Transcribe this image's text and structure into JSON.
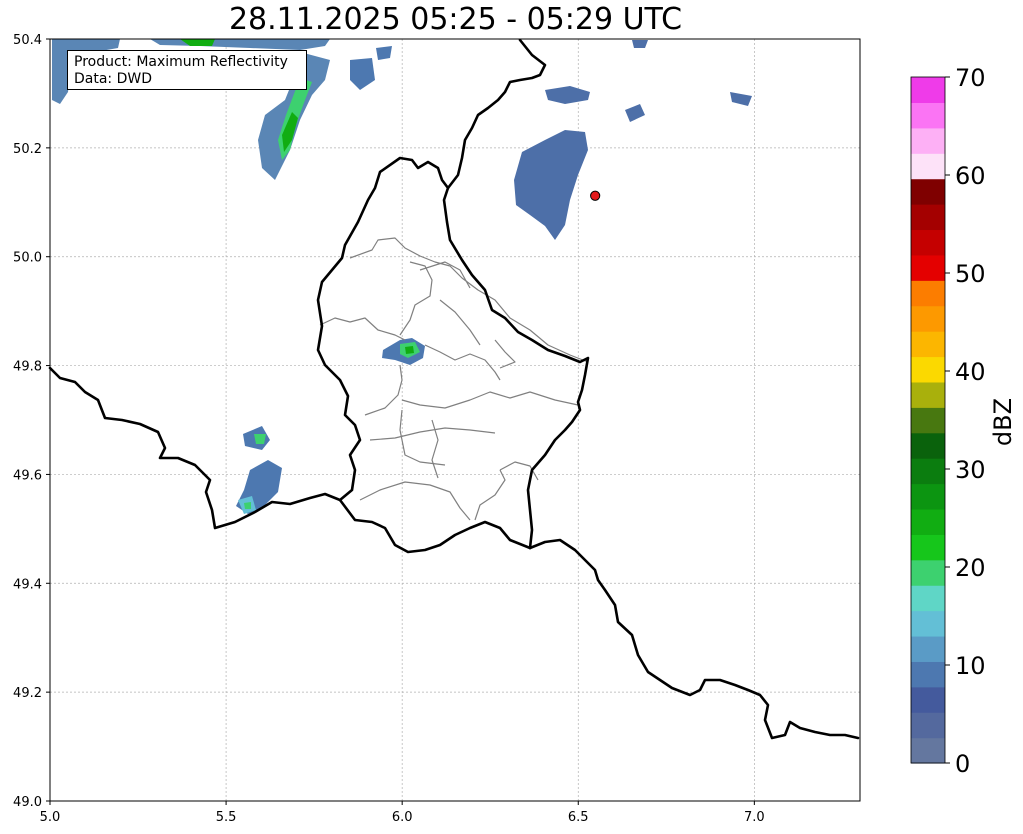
{
  "title": "28.11.2025 05:25 - 05:29 UTC",
  "info": {
    "product_line": "Product: Maximum Reflectivity",
    "data_line": "Data: DWD"
  },
  "map": {
    "lon_range": [
      5.0,
      7.3
    ],
    "lat_range": [
      49.0,
      50.4
    ],
    "x_ticks": [
      "5.0",
      "5.5",
      "6.0",
      "6.5",
      "7.0"
    ],
    "y_ticks": [
      "49.0",
      "49.2",
      "49.4",
      "49.6",
      "49.8",
      "50.0",
      "50.2",
      "50.4"
    ],
    "grid": true,
    "marker": {
      "lon": 6.548,
      "lat": 50.112,
      "color": "#e31a1c"
    }
  },
  "colorbar": {
    "label": "dBZ",
    "ticks": [
      "0",
      "10",
      "20",
      "30",
      "40",
      "50",
      "60",
      "70"
    ],
    "range": [
      0,
      70
    ],
    "colors": [
      "#64779f",
      "#54699e",
      "#445a9d",
      "#4d78b0",
      "#5a9bc6",
      "#63bfd6",
      "#5fd6c6",
      "#3dd16f",
      "#16c61b",
      "#11ad12",
      "#0c9511",
      "#0b7d0f",
      "#0a620c",
      "#487810",
      "#a9b00c",
      "#fbd900",
      "#fcb600",
      "#fd9900",
      "#fc7d00",
      "#e40000",
      "#c50000",
      "#a40000",
      "#7f0000",
      "#fde2f8",
      "#fdb0f5",
      "#fb74f4",
      "#ef3be9"
    ]
  }
}
